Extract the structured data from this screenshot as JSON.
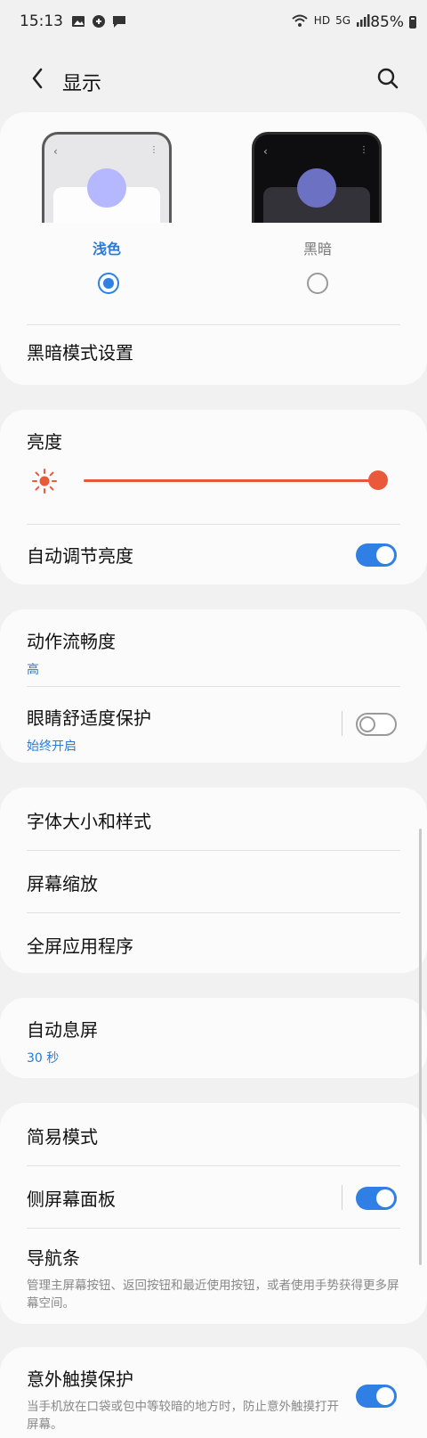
{
  "status_bar": {
    "time": "15:13",
    "network_hd": "HD",
    "network_5g": "5G",
    "battery": "85%"
  },
  "header": {
    "title": "显示"
  },
  "theme": {
    "light_label": "浅色",
    "dark_label": "黑暗",
    "selected": "light",
    "accent_color": "#2f7fe4",
    "dark_mode_settings": "黑暗模式设置"
  },
  "brightness": {
    "label": "亮度",
    "level_percent": 100,
    "adaptive_label": "自动调节亮度",
    "adaptive_on": true,
    "slider_color": "#ea5a3a"
  },
  "motion": {
    "label": "动作流畅度",
    "value": "高"
  },
  "eye_comfort": {
    "label": "眼睛舒适度保护",
    "value": "始终开启",
    "on": false
  },
  "font": {
    "label": "字体大小和样式"
  },
  "zoom": {
    "label": "屏幕缩放"
  },
  "fullscreen": {
    "label": "全屏应用程序"
  },
  "screen_timeout": {
    "label": "自动息屏",
    "value": "30 秒"
  },
  "easy_mode": {
    "label": "简易模式"
  },
  "edge_panels": {
    "label": "侧屏幕面板",
    "on": true
  },
  "nav_bar": {
    "label": "导航条",
    "description": "管理主屏幕按钮、返回按钮和最近使用按钮，或者使用手势获得更多屏幕空间。"
  },
  "accidental_touch": {
    "label": "意外触摸保护",
    "description": "当手机放在口袋或包中等较暗的地方时，防止意外触摸打开屏幕。",
    "on": true
  }
}
